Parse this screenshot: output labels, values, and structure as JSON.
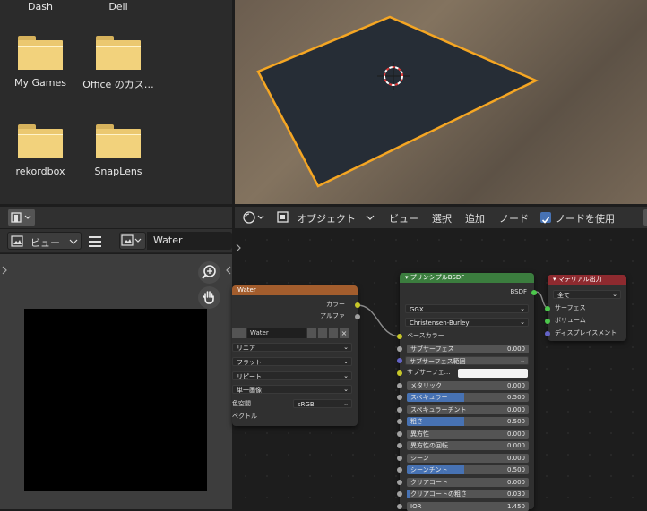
{
  "file_browser": {
    "items": [
      {
        "label": "Dash"
      },
      {
        "label": "Dell"
      },
      {
        "label": "My Games"
      },
      {
        "label": "Office のカス…"
      },
      {
        "label": "rekordbox"
      },
      {
        "label": "SnapLens"
      }
    ]
  },
  "image_editor": {
    "view_label": "ビュー",
    "image_name": "Water"
  },
  "node_editor": {
    "mode_label": "オブジェクト",
    "menu": [
      "ビュー",
      "選択",
      "追加",
      "ノード"
    ],
    "use_nodes_label": "ノードを使用",
    "use_nodes_checked": true
  },
  "texture_node": {
    "title": "Water",
    "out_color": "カラー",
    "out_alpha": "アルファ",
    "image_name": "Water",
    "interpolation": "リニア",
    "projection": "フラット",
    "extension": "リピート",
    "source": "単一画像",
    "colorspace_label": "色空間",
    "colorspace_value": "sRGB",
    "vector_label": "ベクトル"
  },
  "bsdf_node": {
    "title": "プリンシプルBSDF",
    "output": "BSDF",
    "distribution": "GGX",
    "subsurface_method": "Christensen-Burley",
    "base_color_label": "ベースカラー",
    "subsurface_radius_label": "サブサーフェス範囲",
    "subsurface_color_label": "サブサーフェ…",
    "fields": [
      {
        "label": "サブサーフェス",
        "value": "0.000",
        "fill": 0
      },
      {
        "label": "メタリック",
        "value": "0.000",
        "fill": 0
      },
      {
        "label": "スペキュラー",
        "value": "0.500",
        "fill": 0.5
      },
      {
        "label": "スペキュラーチント",
        "value": "0.000",
        "fill": 0
      },
      {
        "label": "粗さ",
        "value": "0.500",
        "fill": 0.5
      },
      {
        "label": "異方性",
        "value": "0.000",
        "fill": 0
      },
      {
        "label": "異方性の回転",
        "value": "0.000",
        "fill": 0
      },
      {
        "label": "シーン",
        "value": "0.000",
        "fill": 0
      },
      {
        "label": "シーンチント",
        "value": "0.500",
        "fill": 0.5
      },
      {
        "label": "クリアコート",
        "value": "0.000",
        "fill": 0
      },
      {
        "label": "クリアコートの粗さ",
        "value": "0.030",
        "fill": 0.03
      },
      {
        "label": "IOR",
        "value": "1.450",
        "fill": 0
      }
    ]
  },
  "output_node": {
    "title": "マテリアル出力",
    "target": "全て",
    "inputs": [
      "サーフェス",
      "ボリューム",
      "ディスプレイスメント"
    ]
  },
  "colors": {
    "texture_header": "#a35d2d",
    "bsdf_header": "#3b7d3e",
    "output_header": "#8e2a2f",
    "accent_blue": "#4772b3",
    "selection_orange": "#f5a623"
  }
}
